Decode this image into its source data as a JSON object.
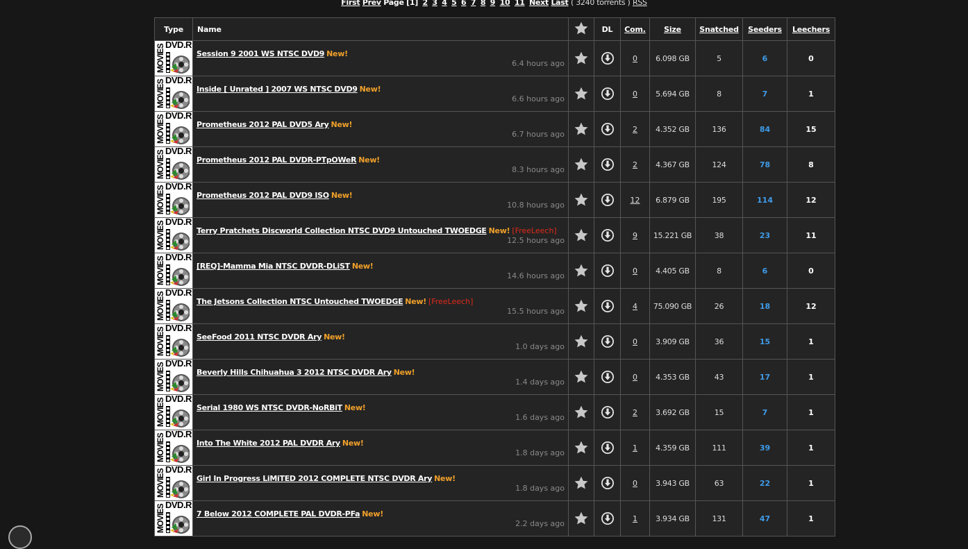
{
  "pager": {
    "first": "First",
    "prev": "Prev",
    "page_label": "Page",
    "current": "[1]",
    "pages": [
      "2",
      "3",
      "4",
      "5",
      "6",
      "7",
      "8",
      "9",
      "10",
      "11"
    ],
    "next": "Next",
    "last": "Last",
    "count": "( 3240 torrents )",
    "rss": "RSS"
  },
  "columns": {
    "type": "Type",
    "name": "Name",
    "dl": "DL",
    "com": "Com.",
    "size": "Size",
    "snatched": "Snatched",
    "seeders": "Seeders",
    "leechers": "Leechers"
  },
  "type_badge": {
    "top": "DVD.R",
    "side": "MOVIES"
  },
  "new_label": "New!",
  "free_label": "[FreeLeech]",
  "rows": [
    {
      "name": "Session 9 2001 WS NTSC DVD9",
      "free": false,
      "age": "6.4 hours ago",
      "com": "0",
      "size": "6.098 GB",
      "snatched": "5",
      "seeders": "6",
      "leechers": "0"
    },
    {
      "name": "Inside [ Unrated ] 2007 WS NTSC DVD9",
      "free": false,
      "age": "6.6 hours ago",
      "com": "0",
      "size": "5.694 GB",
      "snatched": "8",
      "seeders": "7",
      "leechers": "1"
    },
    {
      "name": "Prometheus 2012 PAL DVD5 Ary",
      "free": false,
      "age": "6.7 hours ago",
      "com": "2",
      "size": "4.352 GB",
      "snatched": "136",
      "seeders": "84",
      "leechers": "15"
    },
    {
      "name": "Prometheus 2012 PAL DVDR-PTpOWeR",
      "free": false,
      "age": "8.3 hours ago",
      "com": "2",
      "size": "4.367 GB",
      "snatched": "124",
      "seeders": "78",
      "leechers": "8"
    },
    {
      "name": "Prometheus 2012 PAL DVD9 ISO",
      "free": false,
      "age": "10.8 hours ago",
      "com": "12",
      "size": "6.879 GB",
      "snatched": "195",
      "seeders": "114",
      "leechers": "12"
    },
    {
      "name": "Terry Pratchets Discworld Collection NTSC DVD9 Untouched TWOEDGE",
      "free": true,
      "age": "12.5 hours ago",
      "com": "9",
      "size": "15.221 GB",
      "snatched": "38",
      "seeders": "23",
      "leechers": "11"
    },
    {
      "name": "[REQ]-Mamma Mia NTSC DVDR-DLiST",
      "free": false,
      "age": "14.6 hours ago",
      "com": "0",
      "size": "4.405 GB",
      "snatched": "8",
      "seeders": "6",
      "leechers": "0"
    },
    {
      "name": "The Jetsons Collection NTSC Untouched TWOEDGE",
      "free": true,
      "age": "15.5 hours ago",
      "com": "4",
      "size": "75.090 GB",
      "snatched": "26",
      "seeders": "18",
      "leechers": "12"
    },
    {
      "name": "SeeFood 2011 NTSC DVDR Ary",
      "free": false,
      "age": "1.0 days ago",
      "com": "0",
      "size": "3.909 GB",
      "snatched": "36",
      "seeders": "15",
      "leechers": "1"
    },
    {
      "name": "Beverly Hills Chihuahua 3 2012 NTSC DVDR Ary",
      "free": false,
      "age": "1.4 days ago",
      "com": "0",
      "size": "4.353 GB",
      "snatched": "43",
      "seeders": "17",
      "leechers": "1"
    },
    {
      "name": "Serial 1980 WS NTSC DVDR-NoRBiT",
      "free": false,
      "age": "1.6 days ago",
      "com": "2",
      "size": "3.692 GB",
      "snatched": "15",
      "seeders": "7",
      "leechers": "1"
    },
    {
      "name": "Into The White 2012 PAL DVDR Ary",
      "free": false,
      "age": "1.8 days ago",
      "com": "1",
      "size": "4.359 GB",
      "snatched": "111",
      "seeders": "39",
      "leechers": "1"
    },
    {
      "name": "Girl In Progress LiMiTED 2012 COMPLETE NTSC DVDR Ary",
      "free": false,
      "age": "1.8 days ago",
      "com": "0",
      "size": "3.943 GB",
      "snatched": "63",
      "seeders": "22",
      "leechers": "1"
    },
    {
      "name": "7 Below 2012 COMPLETE PAL DVDR-PFa",
      "free": false,
      "age": "2.2 days ago",
      "com": "1",
      "size": "3.934 GB",
      "snatched": "131",
      "seeders": "47",
      "leechers": "1"
    }
  ],
  "colors": {
    "background": "#171717",
    "row_bg": "#242424",
    "new_label": "#f0a02a",
    "freeleech": "#e02a1a",
    "seeders": "#3e9be9",
    "age_text": "#8a8a8a"
  },
  "icons": {
    "bookmark": "star-icon",
    "download": "download-arrow-icon"
  }
}
